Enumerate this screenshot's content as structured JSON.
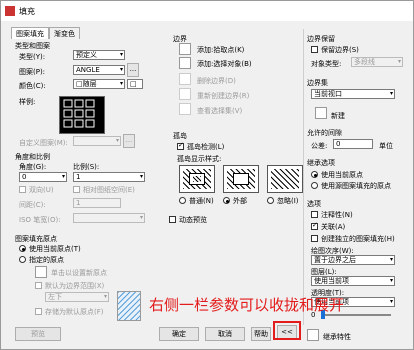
{
  "window": {
    "title": "填充"
  },
  "tabs": [
    "图案填充",
    "渐变色"
  ],
  "type_pattern": {
    "title": "类型和图案",
    "type_label": "类型(Y):",
    "type_value": "预定义",
    "pattern_label": "图案(P):",
    "pattern_value": "ANGLE",
    "pattern_more": "...",
    "color_label": "颜色(C):",
    "color_value": "□随层",
    "color_swatch_label": "□",
    "sample_label": "样例:",
    "custom_label": "自定义图案(M):",
    "custom_more": "..."
  },
  "angle_scale": {
    "title": "角度和比例",
    "angle_label": "角度(G):",
    "angle_value": "0",
    "scale_label": "比例(S):",
    "scale_value": "1",
    "double_label": "双向(U)",
    "relative_label": "相对图纸空间(E)",
    "spacing_label": "间距(C):",
    "spacing_value": "1",
    "iso_label": "ISO 笔宽(O):"
  },
  "origin": {
    "title": "图案填充原点",
    "use_current": "使用当前原点(T)",
    "specified": "指定的原点",
    "click_set": "单击以设置新原点",
    "default_ext": "默认为边界范围(X)",
    "pos_value": "左下",
    "store_default": "存储为默认原点(F)"
  },
  "boundary": {
    "title": "边界",
    "add_pick": "添加:拾取点(K)",
    "add_select": "添加:选择对象(B)",
    "remove": "删除边界(D)",
    "recreate": "重新创建边界(R)",
    "view_select": "查看选择集(V)"
  },
  "islands": {
    "title": "孤岛",
    "detect": "孤岛检测(L)",
    "display_style": "孤岛显示样式:",
    "normal": "普通(N)",
    "outer": "外部",
    "ignore": "忽略(I)"
  },
  "dynamic_preview": "动态预览",
  "boundary_retain": {
    "title": "边界保留",
    "retain": "保留边界(S)",
    "obj_type_label": "对象类型:",
    "obj_type_value": "多段线"
  },
  "boundary_set": {
    "title": "边界集",
    "value": "当前视口",
    "new": "新建"
  },
  "gap": {
    "title": "允许的间隙",
    "tolerance_label": "公差:",
    "tolerance_value": "0",
    "unit": "单位"
  },
  "inherit": {
    "title": "继承选项",
    "use_current": "使用当前原点",
    "use_source": "使用源图案填充的原点"
  },
  "options": {
    "title": "选项",
    "annotative": "注释性(N)",
    "associative": "关联(A)",
    "separate": "创建独立的图案填充(H)",
    "draw_order_label": "绘图次序(W):",
    "draw_order_value": "置于边界之后",
    "layer_label": "图层(L):",
    "layer_value": "使用当前项",
    "transparency_label": "透明度(T):",
    "transparency_value": "使用当前项",
    "transparency_number": "0",
    "inherit_props": "继承特性"
  },
  "buttons": {
    "preview": "预览",
    "ok": "确定",
    "cancel": "取消",
    "help": "帮助",
    "collapse": "<<"
  },
  "annotation": "右侧一栏参数可以收拢和展开"
}
